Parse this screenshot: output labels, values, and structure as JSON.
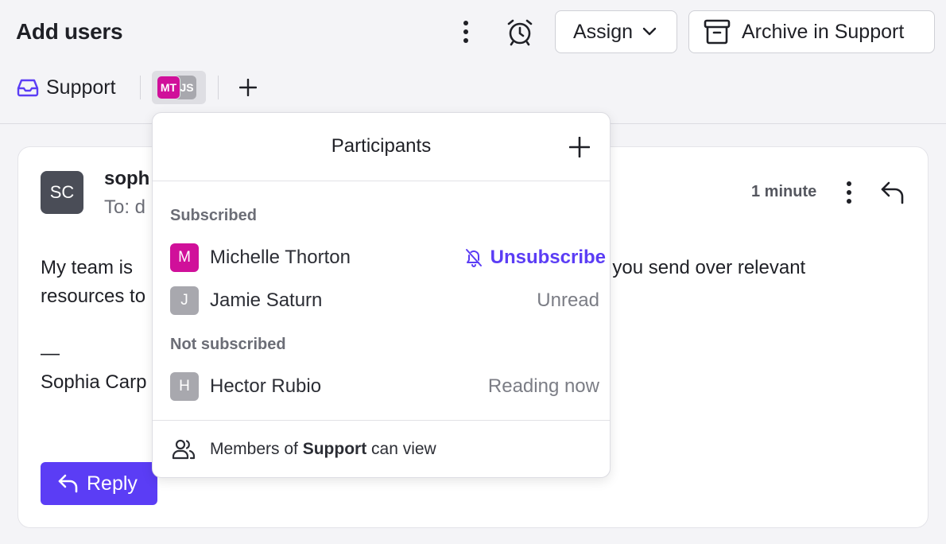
{
  "header": {
    "title": "Add users",
    "assign_label": "Assign",
    "archive_label": "Archive in Support"
  },
  "tabs": {
    "support_label": "Support",
    "avatar_mt": "MT",
    "avatar_js": "JS"
  },
  "message": {
    "sender_initials": "SC",
    "sender_name_visible": "soph",
    "to_visible": "To: d",
    "time": "1 minute",
    "line1_left": "My team is ",
    "line1_right": "art, can you send over relevant",
    "line2_left": "resources to",
    "dash": "—",
    "signature_visible": "Sophia Carp",
    "reply_label": "Reply"
  },
  "participants": {
    "title": "Participants",
    "subscribed_label": "Subscribed",
    "not_subscribed_label": "Not subscribed",
    "subscribed": [
      {
        "initial": "M",
        "name": "Michelle Thorton",
        "action": "Unsubscribe",
        "color": "#d0109a"
      },
      {
        "initial": "J",
        "name": "Jamie Saturn",
        "status": "Unread",
        "color": "#a8a8ae"
      }
    ],
    "not_subscribed": [
      {
        "initial": "H",
        "name": "Hector Rubio",
        "status": "Reading now",
        "color": "#a8a8ae"
      }
    ],
    "footer_prefix": "Members of ",
    "footer_bold": "Support",
    "footer_suffix": " can view"
  },
  "colors": {
    "accent": "#5b3df5",
    "brand_magenta": "#d0109a"
  }
}
